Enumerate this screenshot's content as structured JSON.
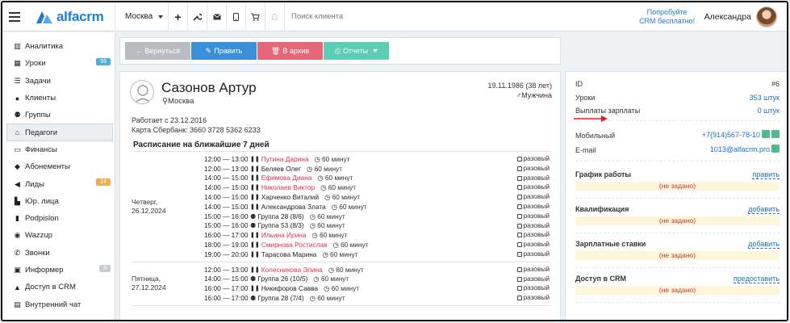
{
  "topbar": {
    "logo": "alfacrm",
    "city": "Москва",
    "search_placeholder": "Поиск клиента",
    "promo_line1": "Попробуйте",
    "promo_line2": "CRM бесплатно!",
    "user": "Александра"
  },
  "sidebar": [
    {
      "label": "Аналитика",
      "icon": "book-icon",
      "badge": ""
    },
    {
      "label": "Уроки",
      "icon": "calendar-icon",
      "badge": "59",
      "badge_color": "#4fb0d7"
    },
    {
      "label": "Задачи",
      "icon": "tasks-icon",
      "badge": ""
    },
    {
      "label": "Клиенты",
      "icon": "user-icon",
      "badge": ""
    },
    {
      "label": "Группы",
      "icon": "users-icon",
      "badge": ""
    },
    {
      "label": "Педагоги",
      "icon": "graduation-cap-icon",
      "badge": "",
      "active": true
    },
    {
      "label": "Финансы",
      "icon": "money-icon",
      "badge": ""
    },
    {
      "label": "Абонементы",
      "icon": "tag-icon",
      "badge": ""
    },
    {
      "label": "Лиды",
      "icon": "bullhorn-icon",
      "badge": "24",
      "badge_color": "#f0ad4e"
    },
    {
      "label": "Юр. лица",
      "icon": "building-icon",
      "badge": ""
    },
    {
      "label": "Podpislon",
      "icon": "file-icon",
      "badge": ""
    },
    {
      "label": "Wazzup",
      "icon": "whatsapp-icon",
      "badge": ""
    },
    {
      "label": "Звонки",
      "icon": "phone-icon",
      "badge": ""
    },
    {
      "label": "Информер",
      "icon": "monitor-icon",
      "badge": "3",
      "badge_color": "#c9ced3"
    },
    {
      "label": "Доступ в CRM",
      "icon": "lock-icon",
      "badge": ""
    },
    {
      "label": "Внутренний чат",
      "icon": "chat-icon",
      "badge": ""
    }
  ],
  "buttons": {
    "back": "← Вернуться",
    "edit": "Править",
    "archive": "В архив",
    "reports": "Отчеты"
  },
  "profile": {
    "name": "Сазонов Артур",
    "city": "Москва",
    "dob": "19.11.1986 (38 лет)",
    "gender": "Мужчина",
    "works_since": "Работает с 23.12.2016",
    "card": "Карта Сбербанк: 3660 3728 5362 6233"
  },
  "schedule": {
    "title": "Расписание на ближайшие 7 дней",
    "once_label": "разовый",
    "days": [
      {
        "label1": "Четверг,",
        "label2": "26.12.2024",
        "rows": [
          {
            "time": "12:00 — 13:00",
            "kind": "person",
            "name": "Путина Дарина",
            "red": true,
            "dur": "60 минут"
          },
          {
            "time": "12:00 — 13:00",
            "kind": "person",
            "name": "Беляев Олег",
            "red": false,
            "dur": "60 минут"
          },
          {
            "time": "14:00 — 15:00",
            "kind": "person",
            "name": "Ефимова Диана",
            "red": true,
            "dur": "60 минут"
          },
          {
            "time": "14:00 — 15:00",
            "kind": "person",
            "name": "Николаев Виктор",
            "red": true,
            "dur": "60 минут"
          },
          {
            "time": "14:00 — 15:00",
            "kind": "person",
            "name": "Харченко Виталий",
            "red": false,
            "dur": "60 минут"
          },
          {
            "time": "14:00 — 15:00",
            "kind": "person",
            "name": "Александрова Злата",
            "red": false,
            "dur": "60 минут"
          },
          {
            "time": "15:00 — 16:00",
            "kind": "group",
            "name": "Группа 28 (8/6)",
            "red": false,
            "dur": "60 минут"
          },
          {
            "time": "15:00 — 16:00",
            "kind": "group",
            "name": "Группа 53 (8/3)",
            "red": false,
            "dur": "60 минут"
          },
          {
            "time": "16:00 — 17:00",
            "kind": "person",
            "name": "Ильина Ирина",
            "red": true,
            "dur": "60 минут"
          },
          {
            "time": "18:00 — 19:00",
            "kind": "person",
            "name": "Смирнова Ростислав",
            "red": true,
            "dur": "60 минут"
          },
          {
            "time": "19:00 — 20:00",
            "kind": "person",
            "name": "Тарасова Марина",
            "red": false,
            "dur": "60 минут"
          }
        ]
      },
      {
        "label1": "Пятница,",
        "label2": "27.12.2024",
        "rows": [
          {
            "time": "12:00 — 13:00",
            "kind": "person",
            "name": "Колесникова Элина",
            "red": true,
            "dur": "60 минут"
          },
          {
            "time": "14:00 — 15:00",
            "kind": "group",
            "name": "Группа 26 (10/5)",
            "red": false,
            "dur": "60 минут"
          },
          {
            "time": "16:00 — 17:00",
            "kind": "person",
            "name": "Никифоров Савва",
            "red": false,
            "dur": "60 минут"
          },
          {
            "time": "16:00 — 17:00",
            "kind": "group",
            "name": "Группа 28 (7/4)",
            "red": false,
            "dur": "60 минут"
          }
        ]
      }
    ]
  },
  "info": {
    "id_label": "ID",
    "id_value": "#6",
    "lessons_label": "Уроки",
    "lessons_value": "353 штук",
    "payouts_label": "Выплаты зарплаты",
    "payouts_value": "0 штук",
    "mobile_label": "Мобильный",
    "mobile_value": "+7(914)567-78-10",
    "email_label": "E-mail",
    "email_value": "1013@alfacrm.pro"
  },
  "sections": [
    {
      "title": "График работы",
      "link": "править",
      "empty": "(не задано)"
    },
    {
      "title": "Квалификация",
      "link": "добавить",
      "empty": "(не задано)"
    },
    {
      "title": "Зарплатные ставки",
      "link": "добавить",
      "empty": "(не задано)"
    },
    {
      "title": "Доступ в CRM",
      "link": "предоставить",
      "empty": "(не задано)"
    }
  ]
}
